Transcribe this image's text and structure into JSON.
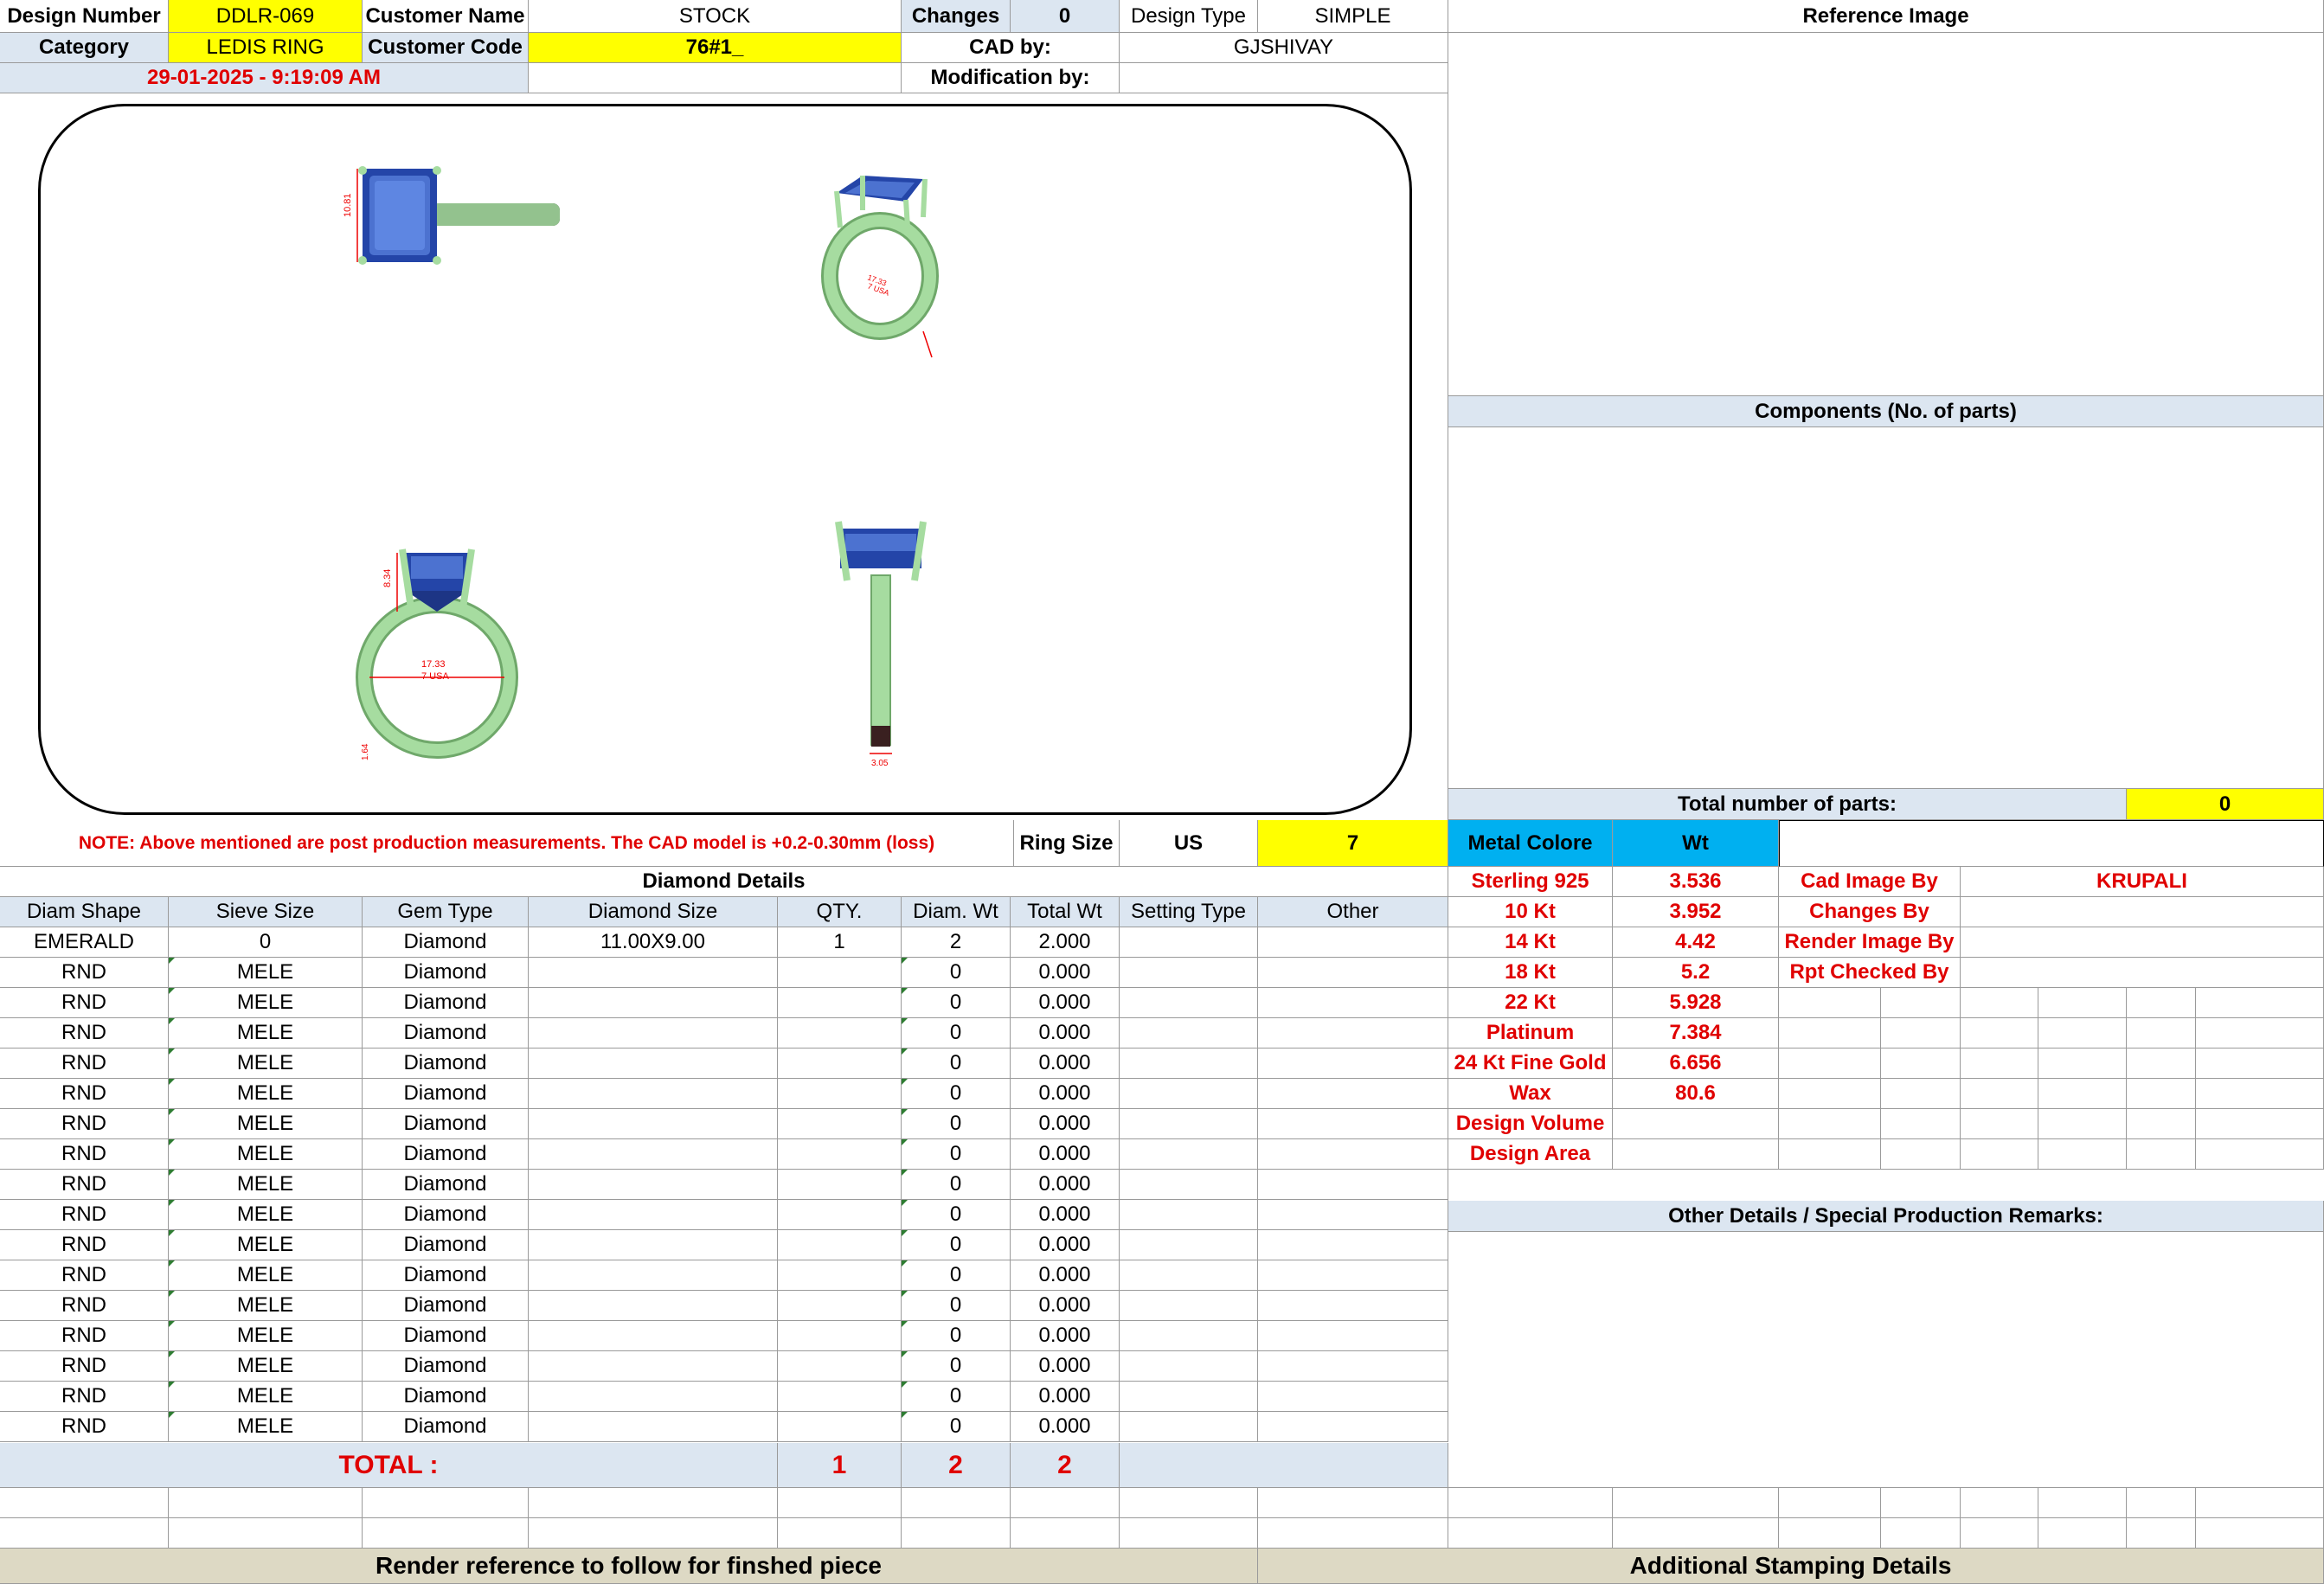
{
  "header": {
    "design_number_label": "Design Number",
    "design_number": "DDLR-069",
    "customer_name_label": "Customer Name",
    "customer_name": "STOCK",
    "changes_label": "Changes",
    "changes": "0",
    "design_type_label": "Design Type",
    "design_type": "SIMPLE",
    "reference_image_label": "Reference Image",
    "category_label": "Category",
    "category": "LEDIS RING",
    "customer_code_label": "Customer Code",
    "customer_code": "76#1_",
    "cad_by_label": "CAD by:",
    "cad_by": "GJSHIVAY",
    "timestamp": "29-01-2025 - 9:19:09 AM",
    "modification_by_label": "Modification by:",
    "modification_by": ""
  },
  "drawing": {
    "dims": [
      "10.81",
      "8.34",
      "17.33",
      "7 USA",
      "1.64",
      "3.05"
    ]
  },
  "components": {
    "title": "Components (No. of parts)",
    "total_label": "Total number of parts:",
    "total": "0"
  },
  "note": {
    "text": "NOTE: Above mentioned are post production measurements. The CAD model is +0.2-0.30mm (loss)",
    "ring_size_label": "Ring Size",
    "ring_size_unit": "US",
    "ring_size": "7"
  },
  "metal": {
    "color_label": "Metal Colore",
    "wt_label": "Wt",
    "rows": [
      {
        "name": "Sterling 925",
        "wt": "3.536"
      },
      {
        "name": "10 Kt",
        "wt": "3.952"
      },
      {
        "name": "14 Kt",
        "wt": "4.42"
      },
      {
        "name": "18 Kt",
        "wt": "5.2"
      },
      {
        "name": "22 Kt",
        "wt": "5.928"
      },
      {
        "name": "Platinum",
        "wt": "7.384"
      },
      {
        "name": "24 Kt Fine Gold",
        "wt": "6.656"
      },
      {
        "name": "Wax",
        "wt": "80.6"
      },
      {
        "name": "Design Volume",
        "wt": ""
      },
      {
        "name": "Design Area",
        "wt": ""
      }
    ]
  },
  "credits": [
    {
      "label": "Cad Image By",
      "value": "KRUPALI"
    },
    {
      "label": "Changes By",
      "value": ""
    },
    {
      "label": "Render Image By",
      "value": ""
    },
    {
      "label": "Rpt Checked By",
      "value": ""
    }
  ],
  "diamonds": {
    "title": "Diamond Details",
    "columns": [
      "Diam Shape",
      "Sieve Size",
      "Gem Type",
      "Diamond Size",
      "QTY.",
      "Diam. Wt",
      "Total Wt",
      "Setting Type",
      "Other"
    ],
    "rows": [
      [
        "EMERALD",
        "0",
        "Diamond",
        "11.00X9.00",
        "1",
        "2",
        "2.000",
        "",
        ""
      ],
      [
        "RND",
        "MELE",
        "Diamond",
        "",
        "",
        "0",
        "0.000",
        "",
        ""
      ],
      [
        "RND",
        "MELE",
        "Diamond",
        "",
        "",
        "0",
        "0.000",
        "",
        ""
      ],
      [
        "RND",
        "MELE",
        "Diamond",
        "",
        "",
        "0",
        "0.000",
        "",
        ""
      ],
      [
        "RND",
        "MELE",
        "Diamond",
        "",
        "",
        "0",
        "0.000",
        "",
        ""
      ],
      [
        "RND",
        "MELE",
        "Diamond",
        "",
        "",
        "0",
        "0.000",
        "",
        ""
      ],
      [
        "RND",
        "MELE",
        "Diamond",
        "",
        "",
        "0",
        "0.000",
        "",
        ""
      ],
      [
        "RND",
        "MELE",
        "Diamond",
        "",
        "",
        "0",
        "0.000",
        "",
        ""
      ],
      [
        "RND",
        "MELE",
        "Diamond",
        "",
        "",
        "0",
        "0.000",
        "",
        ""
      ],
      [
        "RND",
        "MELE",
        "Diamond",
        "",
        "",
        "0",
        "0.000",
        "",
        ""
      ],
      [
        "RND",
        "MELE",
        "Diamond",
        "",
        "",
        "0",
        "0.000",
        "",
        ""
      ],
      [
        "RND",
        "MELE",
        "Diamond",
        "",
        "",
        "0",
        "0.000",
        "",
        ""
      ],
      [
        "RND",
        "MELE",
        "Diamond",
        "",
        "",
        "0",
        "0.000",
        "",
        ""
      ],
      [
        "RND",
        "MELE",
        "Diamond",
        "",
        "",
        "0",
        "0.000",
        "",
        ""
      ],
      [
        "RND",
        "MELE",
        "Diamond",
        "",
        "",
        "0",
        "0.000",
        "",
        ""
      ],
      [
        "RND",
        "MELE",
        "Diamond",
        "",
        "",
        "0",
        "0.000",
        "",
        ""
      ],
      [
        "RND",
        "MELE",
        "Diamond",
        "",
        "",
        "0",
        "0.000",
        "",
        ""
      ]
    ],
    "total_label": "TOTAL :",
    "total_qty": "1",
    "total_diam_wt": "2",
    "total_wt": "2"
  },
  "other_details_title": "Other Details / Special Production Remarks:",
  "footer": {
    "render_ref": "Render reference to follow for finshed piece",
    "stamping": "Additional Stamping Details"
  }
}
